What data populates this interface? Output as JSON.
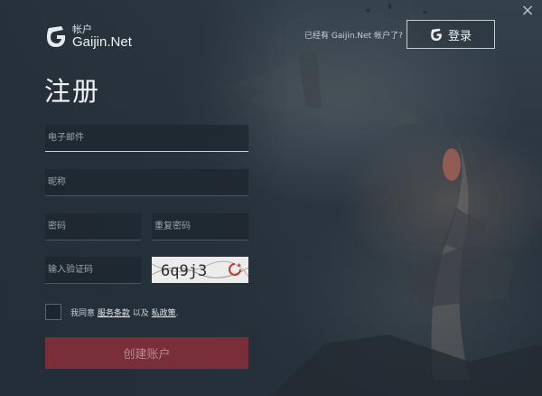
{
  "header": {
    "logo_sub": "帐户",
    "logo_main": "Gaijin.Net",
    "have_account": "已经有 Gaijin.Net 帐户了?",
    "login_label": "登录",
    "close_glyph": "×"
  },
  "form": {
    "title": "注册",
    "email_placeholder": "电子邮件",
    "nickname_placeholder": "昵称",
    "password_placeholder": "密码",
    "repeat_password_placeholder": "重复密码",
    "captcha_placeholder": "输入验证码",
    "captcha_text": "6q9j3",
    "agree_prefix": "我同意",
    "terms_link": "服务条款",
    "agree_middle": "以及",
    "privacy_link": "私政策",
    "agree_suffix": ".",
    "submit_label": "创建账户"
  },
  "colors": {
    "submit_bg": "#7a2e3a",
    "background": "#2c3640"
  },
  "icons": [
    "gaijin-logo-icon",
    "gaijin-login-icon",
    "close-icon",
    "captcha-refresh-icon"
  ]
}
